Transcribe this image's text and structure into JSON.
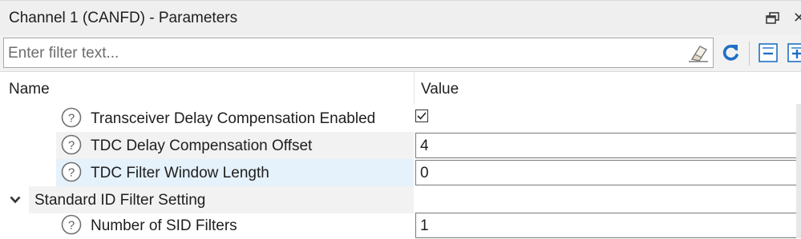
{
  "window": {
    "title": "Channel 1 (CANFD) - Parameters",
    "icons": [
      "restore-icon",
      "close-icon"
    ]
  },
  "toolbar": {
    "filter_placeholder": "Enter filter text...",
    "filter_value": "",
    "icons": [
      "eraser-icon",
      "refresh-icon",
      "collapse-all-icon",
      "expand-all-icon"
    ],
    "accent": "#1f6fc4"
  },
  "columns": {
    "name": "Name",
    "value": "Value"
  },
  "rows": [
    {
      "label": "Transceiver Delay Compensation Enabled",
      "type": "checkbox",
      "checked": true
    },
    {
      "label": "TDC Delay Compensation Offset",
      "type": "text",
      "value": "4"
    },
    {
      "label": "TDC Filter Window Length",
      "type": "text",
      "value": "0",
      "selected": true
    },
    {
      "label": "Standard ID Filter Setting",
      "type": "group",
      "expanded": true
    },
    {
      "label": "Number of SID Filters",
      "type": "text",
      "value": "1"
    }
  ]
}
